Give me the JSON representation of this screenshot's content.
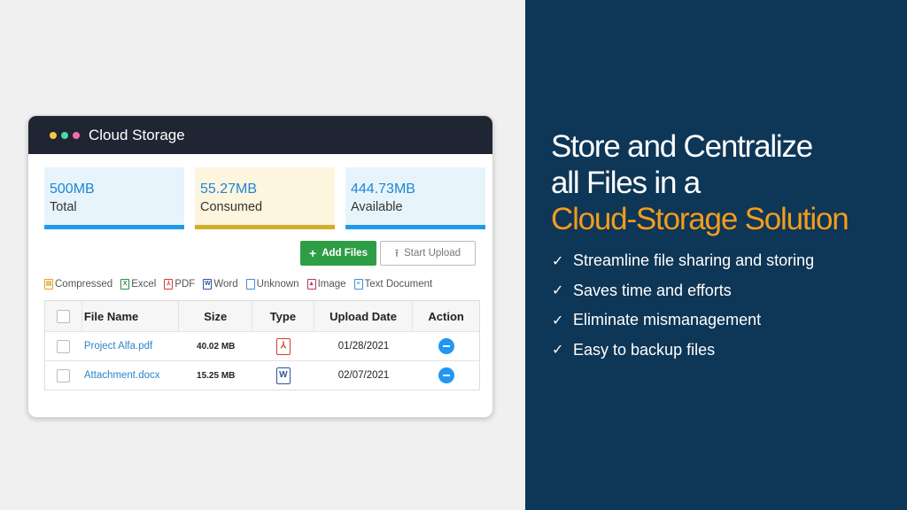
{
  "window": {
    "title": "Cloud Storage",
    "dot_colors": [
      "#f7c646",
      "#4cd7a8",
      "#ef6fa9"
    ]
  },
  "stats": [
    {
      "value": "500MB",
      "label": "Total",
      "bg": "#e8f4fc",
      "bar": "#1e9be6",
      "text_color": "#1f86d4"
    },
    {
      "value": "55.27MB",
      "label": "Consumed",
      "bg": "#fdf5de",
      "bar": "#d3ad2c",
      "text_color": "#1f86d4"
    },
    {
      "value": "444.73MB",
      "label": "Available",
      "bg": "#e8f4fc",
      "bar": "#1e9be6",
      "text_color": "#1f86d4"
    }
  ],
  "actions": {
    "add_files": "Add Files",
    "start_upload": "Start Upload"
  },
  "legend": [
    {
      "label": "Compressed",
      "color": "#e3a31a",
      "icon": "compressed-icon"
    },
    {
      "label": "Excel",
      "color": "#2e8b3e",
      "icon": "excel-icon"
    },
    {
      "label": "PDF",
      "color": "#d63b2e",
      "icon": "pdf-icon"
    },
    {
      "label": "Word",
      "color": "#2b579a",
      "icon": "word-icon"
    },
    {
      "label": "Unknown",
      "color": "#3d8fd8",
      "icon": "unknown-icon"
    },
    {
      "label": "Image",
      "color": "#b8336a",
      "icon": "image-icon"
    },
    {
      "label": "Text Document",
      "color": "#3d8fd8",
      "icon": "text-document-icon"
    }
  ],
  "table": {
    "columns": [
      "File Name",
      "Size",
      "Type",
      "Upload Date",
      "Action"
    ],
    "rows": [
      {
        "name": "Project Alfa.pdf",
        "size": "40.02 MB",
        "type": "pdf",
        "type_glyph": "⅄",
        "type_color": "#d63b2e",
        "date": "01/28/2021"
      },
      {
        "name": "Attachment.docx",
        "size": "15.25 MB",
        "type": "word",
        "type_glyph": "W",
        "type_color": "#2b579a",
        "date": "02/07/2021"
      }
    ]
  },
  "promo": {
    "line1": "Store and Centralize",
    "line2": "all Files in a",
    "line3": "Cloud-Storage Solution",
    "accent_color": "#f39c1e",
    "bullets": [
      "Streamline file sharing and storing",
      "Saves time and efforts",
      "Eliminate mismanagement",
      "Easy to backup files"
    ]
  }
}
